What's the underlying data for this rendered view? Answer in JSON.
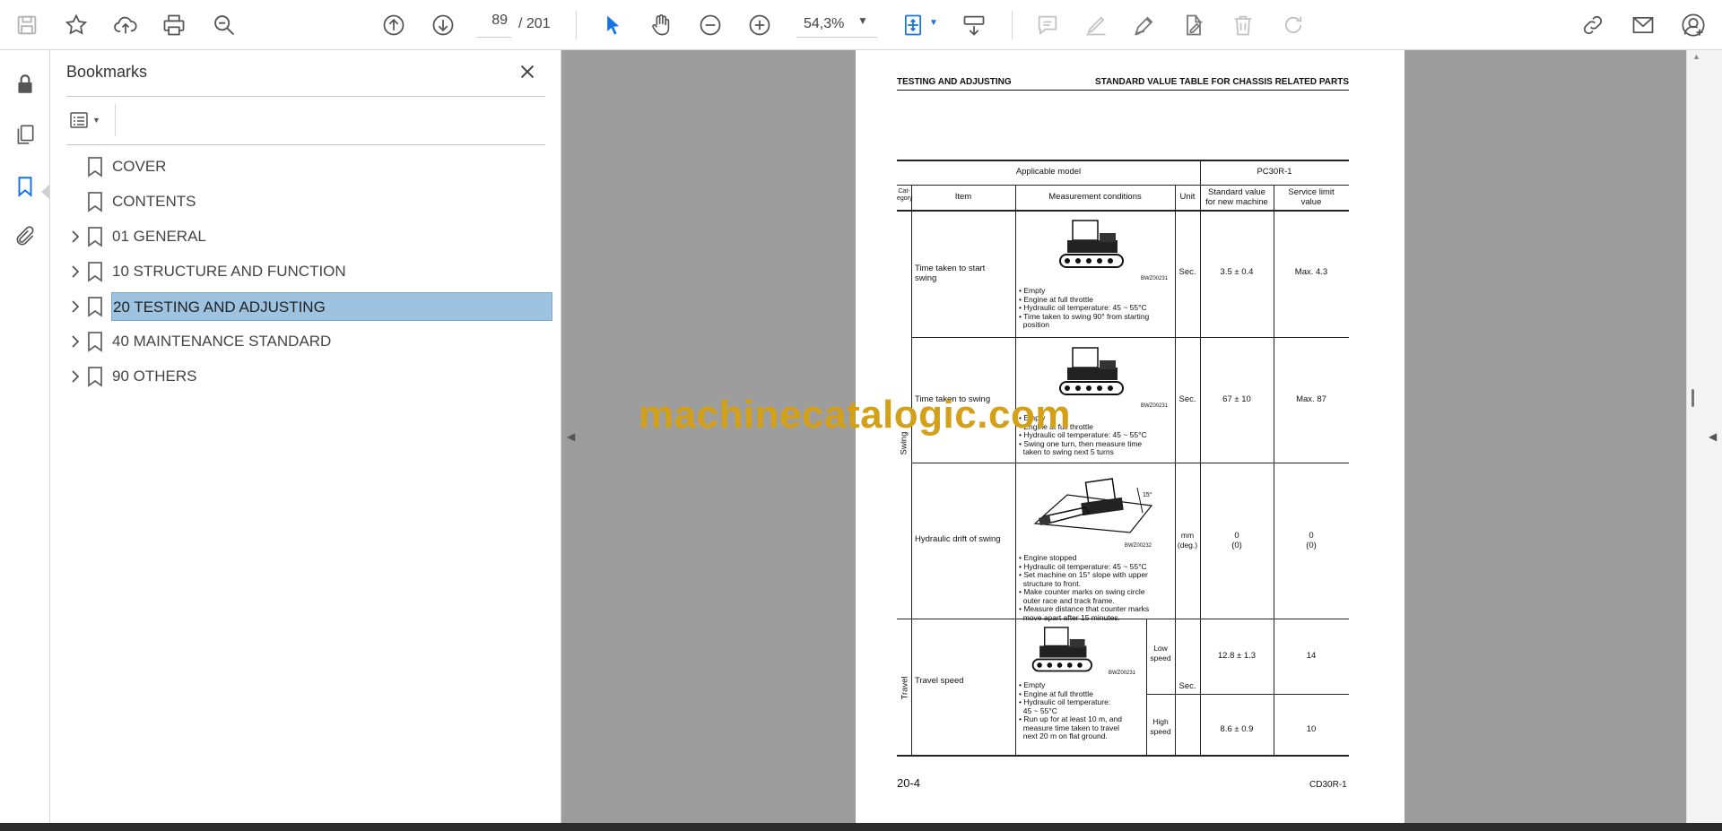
{
  "toolbar": {
    "page_current": "89",
    "page_total": "/ 201",
    "zoom": "54,3%"
  },
  "panel": {
    "title": "Bookmarks",
    "items": [
      {
        "label": "COVER",
        "expandable": false,
        "selected": false
      },
      {
        "label": "CONTENTS",
        "expandable": false,
        "selected": false
      },
      {
        "label": "01 GENERAL",
        "expandable": true,
        "selected": false
      },
      {
        "label": "10 STRUCTURE AND FUNCTION",
        "expandable": true,
        "selected": false
      },
      {
        "label": "20 TESTING AND ADJUSTING",
        "expandable": true,
        "selected": true
      },
      {
        "label": "40 MAINTENANCE STANDARD",
        "expandable": true,
        "selected": false
      },
      {
        "label": "90 OTHERS",
        "expandable": true,
        "selected": false
      }
    ]
  },
  "watermark": "machinecatalogic.com",
  "doc": {
    "header_left": "TESTING AND ADJUSTING",
    "header_right": "STANDARD VALUE TABLE FOR CHASSIS RELATED PARTS",
    "applicable_model_label": "Applicable model",
    "model": "PC30R-1",
    "col_category": "Cat-\negory",
    "col_item": "Item",
    "col_conditions": "Measurement conditions",
    "col_unit": "Unit",
    "col_standard": "Standard value\nfor new machine",
    "col_limit": "Service limit\nvalue",
    "category_swing": "Swing",
    "category_travel": "Travel",
    "rows": [
      {
        "item": "Time taken to start\nswing",
        "fig_code": "BWZ00231",
        "conditions": "• Empty\n• Engine at full throttle\n• Hydraulic oil temperature: 45 ~ 55°C\n• Time taken to swing 90° from starting\n  position",
        "unit": "Sec.",
        "standard": "3.5 ± 0.4",
        "limit": "Max. 4.3"
      },
      {
        "item": "Time taken to swing",
        "fig_code": "BWZ00231",
        "conditions": "• Empty\n• Engine at full throttle\n• Hydraulic oil temperature: 45 ~ 55°C\n• Swing one turn, then measure time\n  taken to swing next 5 turns",
        "unit": "Sec.",
        "standard": "67 ± 10",
        "limit": "Max. 87"
      },
      {
        "item": "Hydraulic drift of swing",
        "fig_code": "BWZ00232",
        "conditions": "• Engine stopped\n• Hydraulic oil temperature: 45 ~ 55°C\n• Set machine on 15° slope with upper\n  structure to front.\n• Make counter marks on swing circle\n  outer race and track frame.\n• Measure distance that counter marks\n  move apart after 15 minutes.",
        "unit": "mm\n(deg.)",
        "standard": "0\n(0)",
        "limit": "0\n(0)"
      },
      {
        "item": "Travel speed",
        "fig_code": "BWZ00231",
        "conditions": "• Empty\n• Engine at full throttle\n• Hydraulic oil temperature:\n  45 ~ 55°C\n• Run up for at least 10 m, and\n  measure time taken to travel\n  next 20 m on flat ground.",
        "unit": "Sec.",
        "low_label": "Low\nspeed",
        "high_label": "High\nspeed",
        "standard_low": "12.8 ± 1.3",
        "limit_low": "14",
        "standard_high": "8.6 ± 0.9",
        "limit_high": "10"
      }
    ],
    "footer_left": "20-4",
    "footer_right": "CD30R-1"
  }
}
